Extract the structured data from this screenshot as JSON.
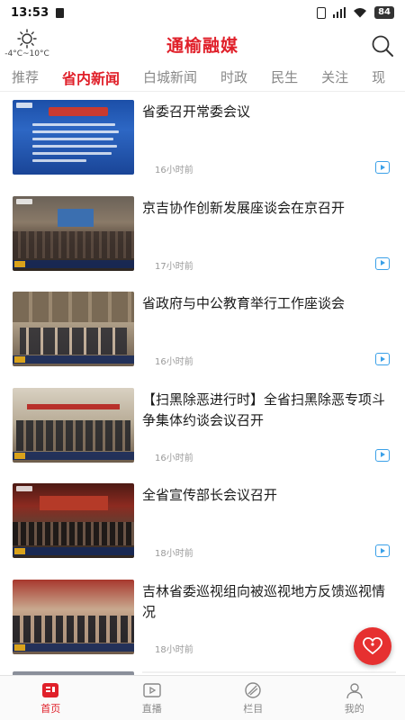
{
  "status_bar": {
    "time": "13:53",
    "battery": "84"
  },
  "header": {
    "app_title": "通榆融媒",
    "weather_temp": "-4°C~10°C"
  },
  "tabs": [
    {
      "label": "推荐",
      "active": false
    },
    {
      "label": "省内新闻",
      "active": true
    },
    {
      "label": "白城新闻",
      "active": false
    },
    {
      "label": "时政",
      "active": false
    },
    {
      "label": "民生",
      "active": false
    },
    {
      "label": "关注",
      "active": false
    },
    {
      "label": "现",
      "active": false
    }
  ],
  "news": [
    {
      "title": "省委召开常委会议",
      "time": "16小时前",
      "type": "video"
    },
    {
      "title": "京吉协作创新发展座谈会在京召开",
      "time": "17小时前",
      "type": "video"
    },
    {
      "title": "省政府与中公教育举行工作座谈会",
      "time": "16小时前",
      "type": "video"
    },
    {
      "title": "【扫黑除恶进行时】全省扫黑除恶专项斗争集体约谈会议召开",
      "time": "16小时前",
      "type": "video"
    },
    {
      "title": "全省宣传部长会议召开",
      "time": "18小时前",
      "type": "video"
    },
    {
      "title": "吉林省委巡视组向被巡视地方反馈巡视情况",
      "time": "18小时前",
      "type": "video"
    }
  ],
  "bottom_nav": [
    {
      "label": "首页",
      "icon": "home-icon",
      "active": true
    },
    {
      "label": "直播",
      "icon": "live-icon",
      "active": false
    },
    {
      "label": "栏目",
      "icon": "column-icon",
      "active": false
    },
    {
      "label": "我的",
      "icon": "profile-icon",
      "active": false
    }
  ],
  "colors": {
    "accent": "#e0202a",
    "video_icon": "#3aa0e8",
    "fab": "#e63030"
  }
}
